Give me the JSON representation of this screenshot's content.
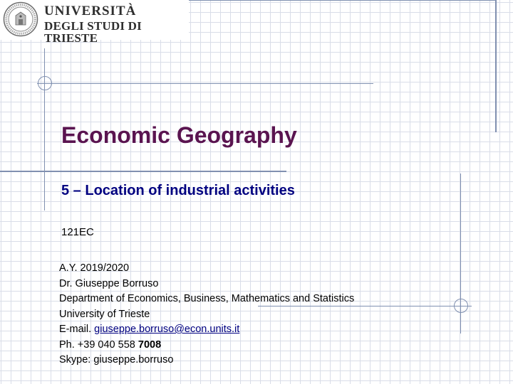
{
  "header": {
    "university_line1": "UNIVERSITÀ",
    "university_line2": "DEGLI STUDI DI TRIESTE",
    "seal_icon": "university-seal-icon"
  },
  "slide": {
    "title": "Economic Geography",
    "subtitle": "5 – Location of industrial activities",
    "course_code": "121EC",
    "academic_year": "A.Y. 2019/2020",
    "lecturer": "Dr. Giuseppe Borruso",
    "department": "Department of Economics, Business, Mathematics and Statistics",
    "university": "University of Trieste",
    "email_label": "E-mail. ",
    "email": "giuseppe.borruso@econ.units.it",
    "phone_prefix": "Ph. +39 040 558 ",
    "phone_ext": "7008",
    "skype": "Skype:  giuseppe.borruso"
  },
  "colors": {
    "title": "#5a1450",
    "subtitle": "#000080",
    "decoration": "#8090b0",
    "grid": "#d9dde8"
  }
}
